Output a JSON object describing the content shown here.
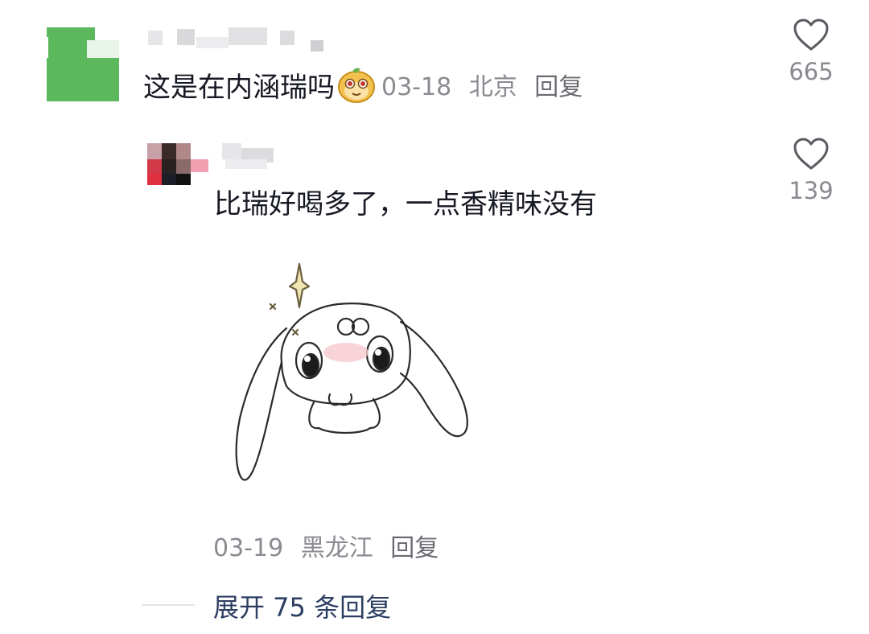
{
  "comment": {
    "text": "这是在内涵瑞吗",
    "emoji_icon": "monkey-face-emoji",
    "date": "03-18",
    "location": "北京",
    "reply_label": "回复",
    "likes": "665"
  },
  "reply": {
    "text": "比瑞好喝多了，一点香精味没有",
    "sticker_icon": "bunny-sticker",
    "date": "03-19",
    "location": "黑龙江",
    "reply_label": "回复",
    "likes": "139"
  },
  "expand": {
    "label": "展开 75 条回复"
  },
  "colors": {
    "text": "#161823",
    "meta": "#8a8b91",
    "link": "#2c3e62"
  }
}
